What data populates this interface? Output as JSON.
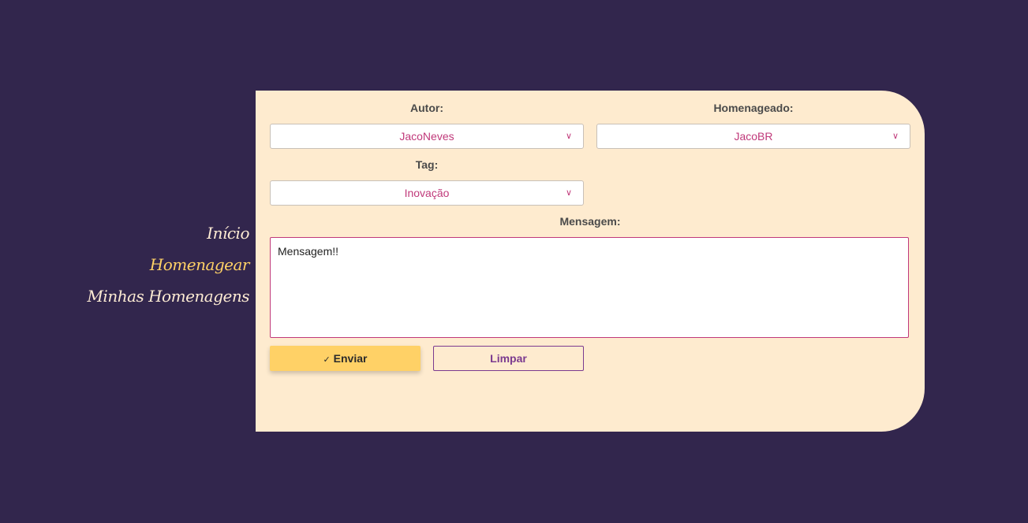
{
  "nav": {
    "items": [
      {
        "label": "Início",
        "active": false
      },
      {
        "label": "Homenagear",
        "active": true
      },
      {
        "label": "Minhas Homenagens",
        "active": false
      }
    ]
  },
  "form": {
    "autor_label": "Autor:",
    "autor_value": "JacoNeves",
    "homenageado_label": "Homenageado:",
    "homenageado_value": "JacoBR",
    "tag_label": "Tag:",
    "tag_value": "Inovação",
    "mensagem_label": "Mensagem:",
    "mensagem_value": "Mensagem!!",
    "enviar_icon": "✓",
    "enviar_label": "Enviar",
    "limpar_label": "Limpar"
  },
  "colors": {
    "background": "#32264d",
    "panel": "#feebcf",
    "accent": "#c0397a",
    "primary_button": "#ffd166",
    "secondary": "#7b3a8f"
  }
}
